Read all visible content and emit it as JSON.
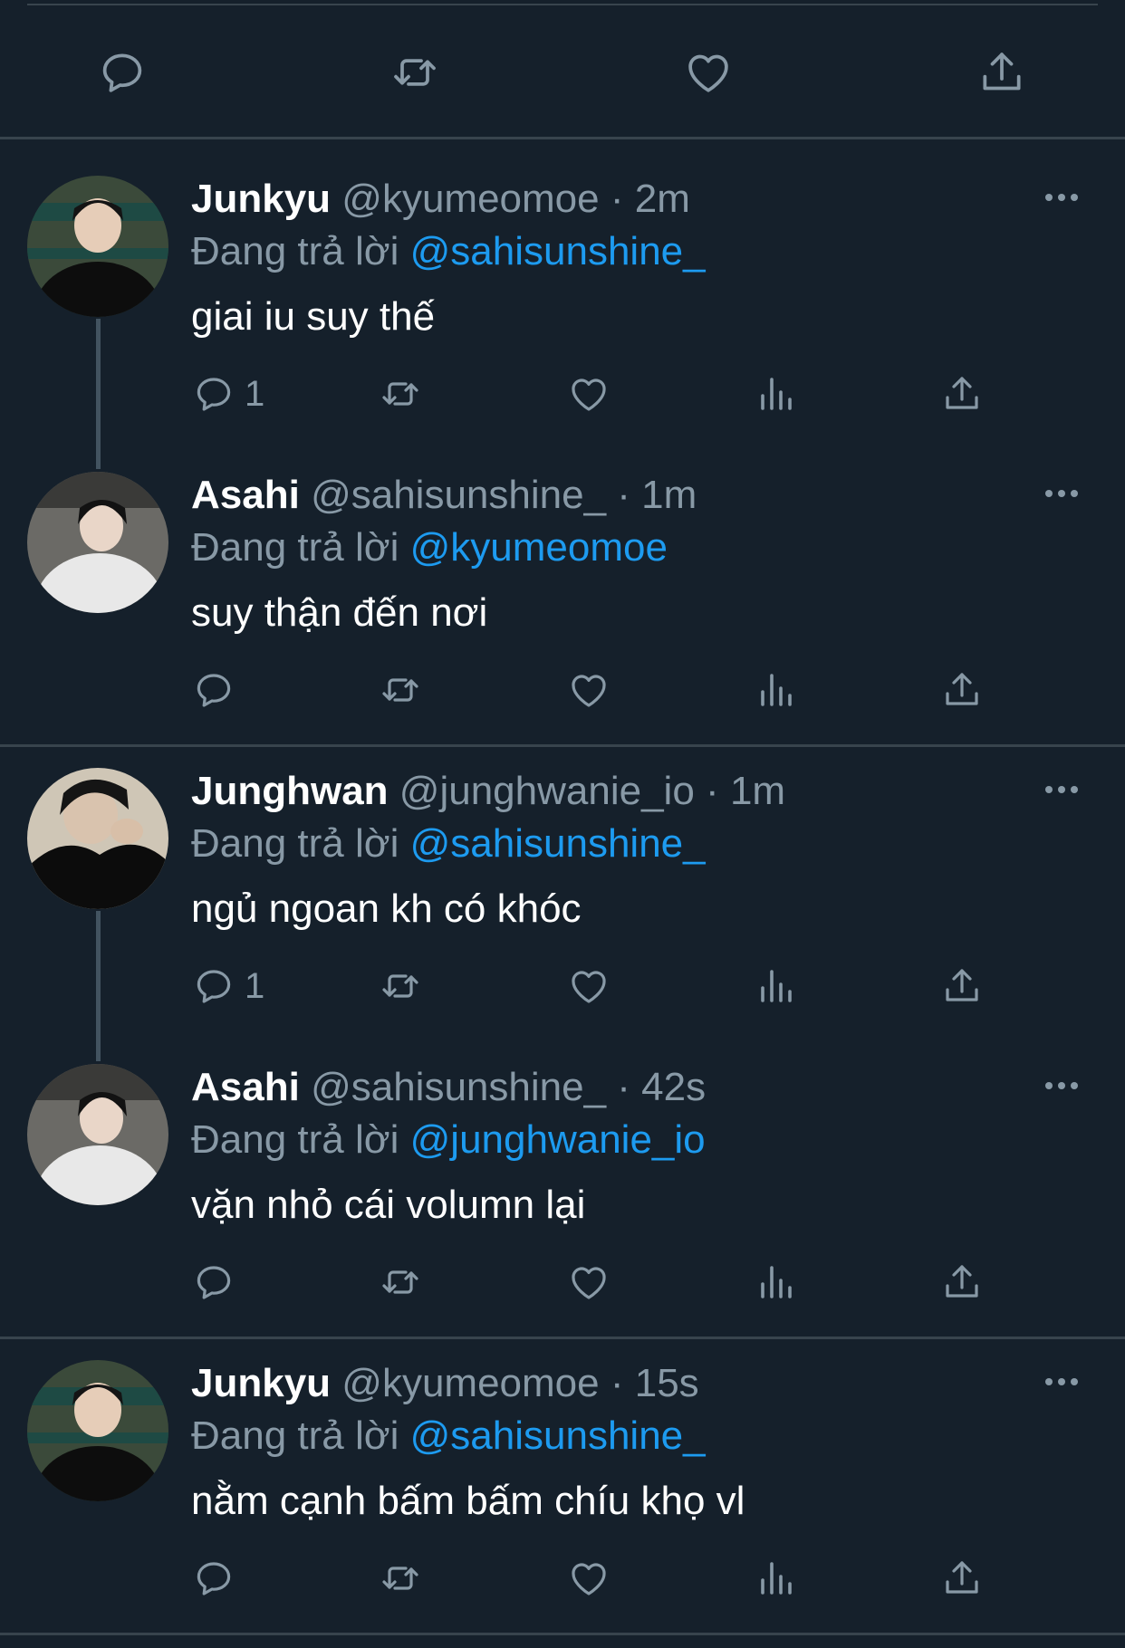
{
  "top_actions": [
    "reply-icon",
    "retweet-icon",
    "like-icon",
    "share-icon"
  ],
  "reply_prefix": "Đang trả lời",
  "tweets": [
    {
      "name": "Junkyu",
      "handle": "@kyumeomoe",
      "dot": "·",
      "time": "2m",
      "reply_to": "@sahisunshine_",
      "text": "giai iu suy thế",
      "reply_count": "1"
    },
    {
      "name": "Asahi",
      "handle": "@sahisunshine_",
      "dot": "·",
      "time": "1m",
      "reply_to": "@kyumeomoe",
      "text": "suy thận đến nơi",
      "reply_count": ""
    },
    {
      "name": "Junghwan",
      "handle": "@junghwanie_io",
      "dot": "·",
      "time": "1m",
      "reply_to": "@sahisunshine_",
      "text": "ngủ ngoan kh có khóc",
      "reply_count": "1"
    },
    {
      "name": "Asahi",
      "handle": "@sahisunshine_",
      "dot": "·",
      "time": "42s",
      "reply_to": "@junghwanie_io",
      "text": "vặn nhỏ cái volumn lại",
      "reply_count": ""
    },
    {
      "name": "Junkyu",
      "handle": "@kyumeomoe",
      "dot": "·",
      "time": "15s",
      "reply_to": "@sahisunshine_",
      "text": "nằm cạnh bấm bấm chíu khọ vl",
      "reply_count": ""
    }
  ],
  "colors": {
    "background": "#15202b",
    "divider": "#38444d",
    "muted": "#8899a6",
    "mention": "#1d9bf0",
    "text": "#ffffff"
  }
}
